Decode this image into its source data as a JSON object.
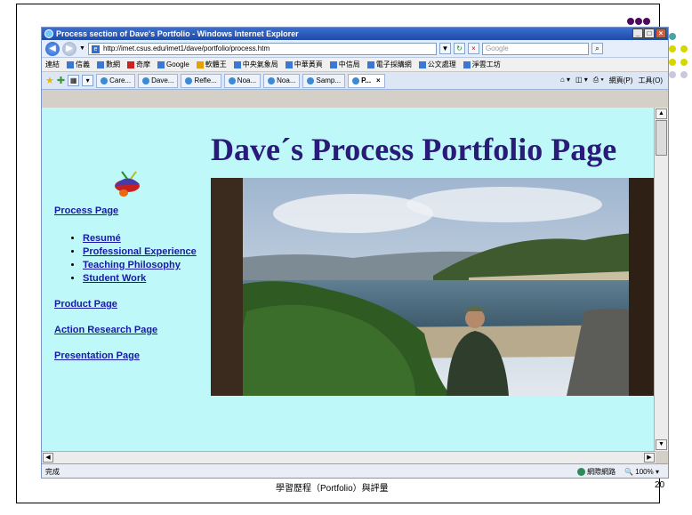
{
  "browser": {
    "window_title": "Process section of Dave's Portfolio - Windows Internet Explorer",
    "address": "http://imet.csus.edu/imet1/dave/portfolio/process.htm",
    "search_placeholder": "Google",
    "links": [
      {
        "label": "連結"
      },
      {
        "label": "信義"
      },
      {
        "label": "數網"
      },
      {
        "label": "奇摩"
      },
      {
        "label": "Google"
      },
      {
        "label": "軟體王"
      },
      {
        "label": "中央氣象局"
      },
      {
        "label": "中華黃頁"
      },
      {
        "label": "中信局"
      },
      {
        "label": "電子採購網"
      },
      {
        "label": "公文處理"
      },
      {
        "label": "淨雲工坊"
      }
    ],
    "tabs": [
      {
        "label": "Care..."
      },
      {
        "label": "Dave..."
      },
      {
        "label": "Refle..."
      },
      {
        "label": "Noa..."
      },
      {
        "label": "Noa..."
      },
      {
        "label": "Samp..."
      },
      {
        "label": "P..."
      }
    ],
    "commands": {
      "page": "網頁(P)",
      "tools": "工具(O)"
    },
    "status": {
      "left": "完成",
      "zone": "網際網路",
      "zoom": "100%"
    }
  },
  "page": {
    "title": "Dave´s Process Portfolio Page",
    "nav": {
      "process": "Process Page",
      "sub_items": [
        {
          "label": "Resumé"
        },
        {
          "label": "Professional Experience"
        },
        {
          "label": "Teaching Philosophy"
        },
        {
          "label": "Student Work"
        }
      ],
      "product": "Product Page",
      "action_research": "Action Research Page",
      "presentation": "Presentation Page"
    }
  },
  "slide": {
    "footer": "學習歷程（Portfolio）與評量",
    "page_number": "20"
  },
  "colors": {
    "page_bg": "#bff8f8",
    "title": "#2a1a7a",
    "link": "#1a1aa8",
    "dot_purple": "#4b0a5c",
    "dot_yellow": "#d6d600",
    "dot_teal": "#4aa3a3",
    "dot_light": "#c9c9dd"
  }
}
